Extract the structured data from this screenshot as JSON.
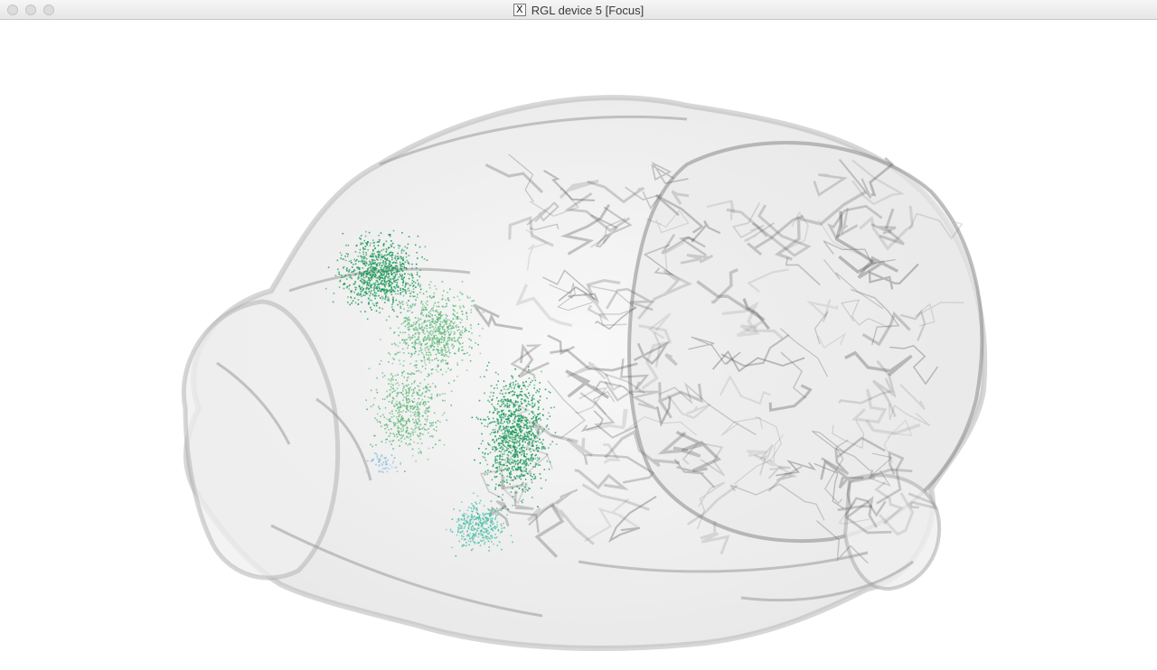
{
  "window": {
    "title": "RGL device 5 [Focus]",
    "title_icon": "x11-icon",
    "buttons": [
      "close",
      "minimize",
      "zoom"
    ]
  },
  "scene": {
    "description_icon": "brain-mesh",
    "mesh_color": "#e8e8e8",
    "edge_color": "#555555",
    "point_colors": [
      "#1e9a5a",
      "#5fb87a",
      "#4fc0a8",
      "#8fbfe0"
    ]
  }
}
